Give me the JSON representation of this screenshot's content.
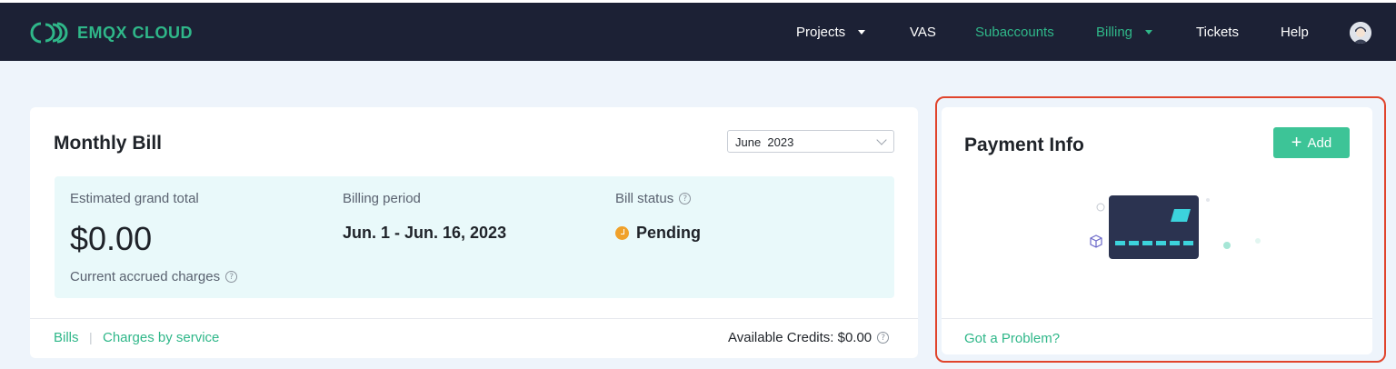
{
  "header": {
    "brand": "EMQX CLOUD",
    "nav": [
      {
        "label": "Projects",
        "dropdown": true,
        "color": "#ffffff"
      },
      {
        "label": "VAS",
        "dropdown": false,
        "color": "#ffffff"
      },
      {
        "label": "Subaccounts",
        "dropdown": false,
        "color": "#2fb789"
      },
      {
        "label": "Billing",
        "dropdown": true,
        "color": "#2fb789"
      },
      {
        "label": "Tickets",
        "dropdown": false,
        "color": "#ffffff"
      },
      {
        "label": "Help",
        "dropdown": false,
        "color": "#ffffff"
      }
    ],
    "avatar_icon": "user-avatar-icon"
  },
  "monthly_bill": {
    "title": "Monthly Bill",
    "month_selected": "June  2023",
    "estimated_label": "Estimated grand total",
    "amount": "$0.00",
    "accrued_label": "Current accrued charges",
    "period_label": "Billing period",
    "period_value": "Jun. 1 - Jun. 16, 2023",
    "status_label": "Bill status",
    "status_value": "Pending",
    "status_color": "#f0a12a",
    "link_bills": "Bills",
    "separator": "|",
    "link_charges": "Charges by service",
    "credits": "Available Credits: $0.00"
  },
  "payment_info": {
    "title": "Payment Info",
    "add_label": "Add",
    "problem_link": "Got a Problem?"
  },
  "colors": {
    "accent": "#2fb789",
    "nav_bg": "#1c2135",
    "highlight": "#e0442c",
    "card_illustration": "#2b3350"
  }
}
